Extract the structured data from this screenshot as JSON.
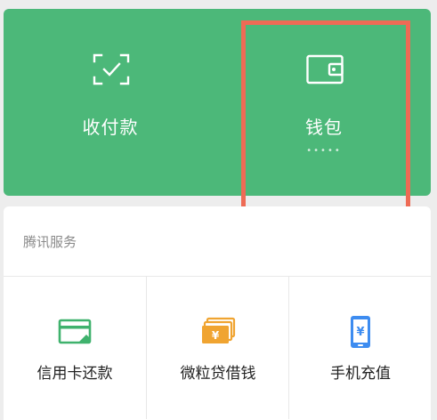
{
  "top_actions": {
    "pay": {
      "label": "收付款",
      "icon": "scan-check-icon"
    },
    "wallet": {
      "label": "钱包",
      "icon": "wallet-icon",
      "masked_balance": "•••••"
    }
  },
  "services": {
    "title": "腾讯服务",
    "items": [
      {
        "label": "信用卡还款",
        "icon": "credit-card-icon",
        "color": "#3fb26d"
      },
      {
        "label": "微粒贷借钱",
        "icon": "cash-stack-icon",
        "color": "#f0a431"
      },
      {
        "label": "手机充值",
        "icon": "phone-topup-icon",
        "color": "#3d8cf0"
      }
    ]
  },
  "colors": {
    "top_card": "#4cb879",
    "highlight": "#ee6b55",
    "page_bg": "#ededed"
  }
}
